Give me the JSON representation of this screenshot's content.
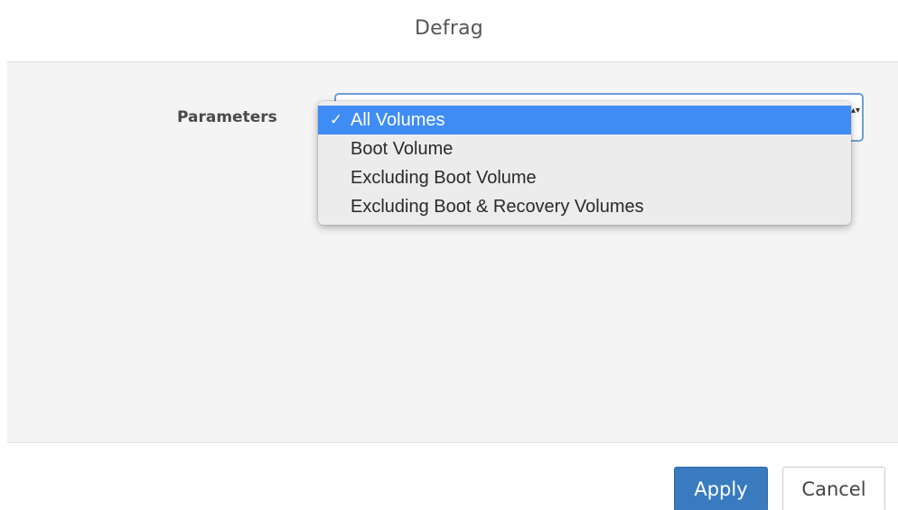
{
  "dialog": {
    "title": "Defrag"
  },
  "form": {
    "parameters_label": "Parameters",
    "select": {
      "selected_value": "All Volumes",
      "arrows_glyph": "▴▾",
      "options": [
        {
          "label": "All Volumes",
          "selected": true,
          "check": "✓"
        },
        {
          "label": "Boot Volume",
          "selected": false
        },
        {
          "label": "Excluding Boot Volume",
          "selected": false
        },
        {
          "label": "Excluding Boot & Recovery Volumes",
          "selected": false
        }
      ]
    }
  },
  "footer": {
    "apply_label": "Apply",
    "cancel_label": "Cancel"
  },
  "colors": {
    "accent": "#3a7bbf",
    "menu_highlight": "#3f8cf4",
    "body_background": "#f4f4f5"
  },
  "icons": {
    "check": "checkmark-icon",
    "select_arrows": "updown-arrows-icon"
  }
}
